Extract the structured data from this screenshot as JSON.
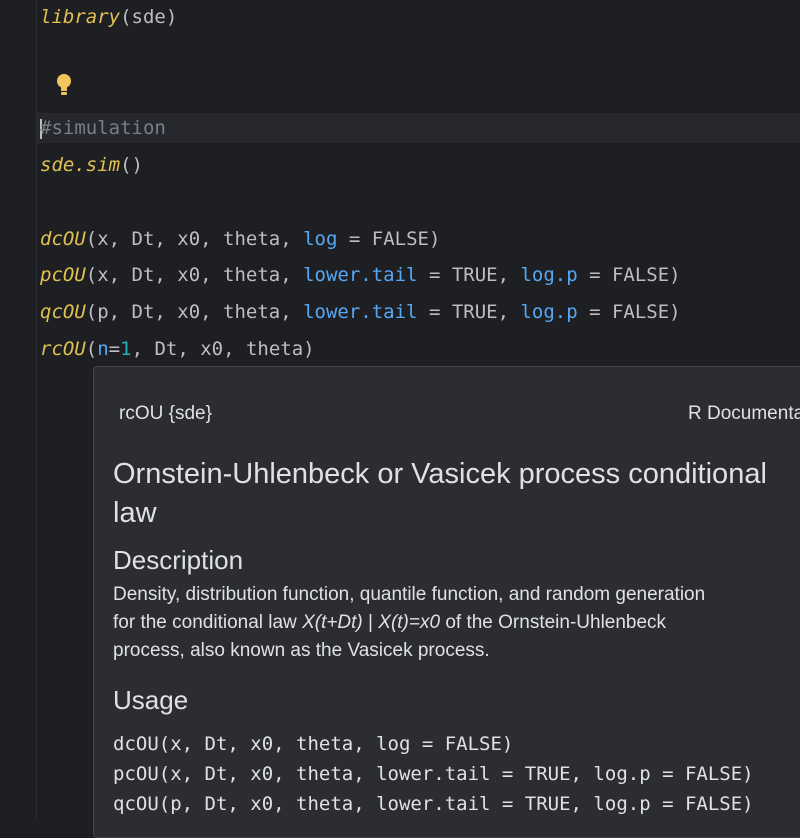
{
  "editor": {
    "lines": {
      "l1": {
        "fn": "library",
        "rest": "(sde)"
      },
      "l2": {
        "comment": "#simulation"
      },
      "l3": {
        "fn": "sde.sim",
        "rest": "()"
      },
      "l4": {
        "fn": "dcOU",
        "a": "(x, Dt, x0, theta, ",
        "arg1": "log",
        "b": " = FALSE)"
      },
      "l5": {
        "fn": "pcOU",
        "a": "(x, Dt, x0, theta, ",
        "arg1": "lower.tail",
        "b": " = TRUE, ",
        "arg2": "log.p",
        "c": " = FALSE)"
      },
      "l6": {
        "fn": "qcOU",
        "a": "(p, Dt, x0, theta, ",
        "arg1": "lower.tail",
        "b": " = TRUE, ",
        "arg2": "log.p",
        "c": " = FALSE)"
      },
      "l7": {
        "fn": "rcOU",
        "a": "(",
        "arg1": "n",
        "eq": "=",
        "num": "1",
        "b": ", Dt, x0, theta)"
      }
    }
  },
  "doc_popup": {
    "header_left": "rcOU {sde}",
    "header_right": "R Documentation",
    "title": "Ornstein-Uhlenbeck or Vasicek process conditional law",
    "description_heading": "Description",
    "description": {
      "line1": "Density, distribution function, quantile function, and random generation",
      "line2_a": "for the conditional law ",
      "line2_math1": "X(t+Dt)",
      "line2_sep": " | ",
      "line2_math2": "X(t)=x0",
      "line2_b": " of the Ornstein-Uhlenbeck",
      "line3": "process, also known as the Vasicek process."
    },
    "usage_heading": "Usage",
    "usage": [
      "dcOU(x, Dt, x0, theta, log = FALSE)",
      "pcOU(x, Dt, x0, theta, lower.tail = TRUE, log.p = FALSE)",
      "qcOU(p, Dt, x0, theta, lower.tail = TRUE, log.p = FALSE)"
    ]
  },
  "colors": {
    "editor_bg": "#1e1f22",
    "function": "#e0c050",
    "named_arg": "#56a8f5",
    "number": "#2aacb8",
    "comment": "#7a7e85",
    "popup_bg": "#2b2d30",
    "bulb": "#f2c55c"
  },
  "icons": {
    "bulb": "lightbulb-icon"
  }
}
